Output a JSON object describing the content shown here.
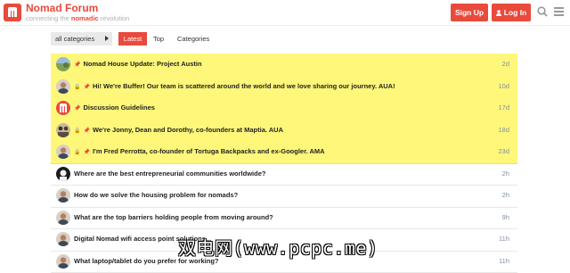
{
  "header": {
    "title": "Nomad Forum",
    "tagline_pre": "connecting the ",
    "tagline_strong": "nomadic",
    "tagline_post": " revolution",
    "signup_label": "Sign Up",
    "login_label": "Log In",
    "brand_color": "#e84a3c"
  },
  "nav": {
    "category_select": "all categories",
    "tabs": [
      {
        "label": "Latest",
        "active": true
      },
      {
        "label": "Top",
        "active": false
      },
      {
        "label": "Categories",
        "active": false
      }
    ]
  },
  "topics": [
    {
      "title": "Nomad House Update: Project Austin",
      "age": "2d",
      "pinned": true,
      "locked": false,
      "avatar": "landscape"
    },
    {
      "title": "Hi! We're Buffer! Our team is scattered around the world and we love sharing our journey. AUA!",
      "age": "10d",
      "pinned": true,
      "locked": true,
      "avatar": "person"
    },
    {
      "title": "Discussion Guidelines",
      "age": "17d",
      "pinned": true,
      "locked": false,
      "avatar": "logo"
    },
    {
      "title": "We're Jonny, Dean and Dorothy, co-founders at Maptia. AUA",
      "age": "18d",
      "pinned": true,
      "locked": true,
      "avatar": "group"
    },
    {
      "title": "I'm Fred Perrotta, co-founder of Tortuga Backpacks and ex-Googler. AMA",
      "age": "23d",
      "pinned": true,
      "locked": true,
      "avatar": "person"
    },
    {
      "title": "Where are the best entrepreneurial communities worldwide?",
      "age": "2h",
      "pinned": false,
      "locked": false,
      "avatar": "dark"
    },
    {
      "title": "How do we solve the housing problem for nomads?",
      "age": "2h",
      "pinned": false,
      "locked": false,
      "avatar": "person"
    },
    {
      "title": "What are the top barriers holding people from moving around?",
      "age": "9h",
      "pinned": false,
      "locked": false,
      "avatar": "person"
    },
    {
      "title": "Digital Nomad wifi access point solutions...",
      "age": "11h",
      "pinned": false,
      "locked": false,
      "avatar": "person"
    },
    {
      "title": "What laptop/tablet do you prefer for working?",
      "age": "11h",
      "pinned": false,
      "locked": false,
      "avatar": "person"
    }
  ],
  "watermark": "双电网(www.pcpc.me)"
}
